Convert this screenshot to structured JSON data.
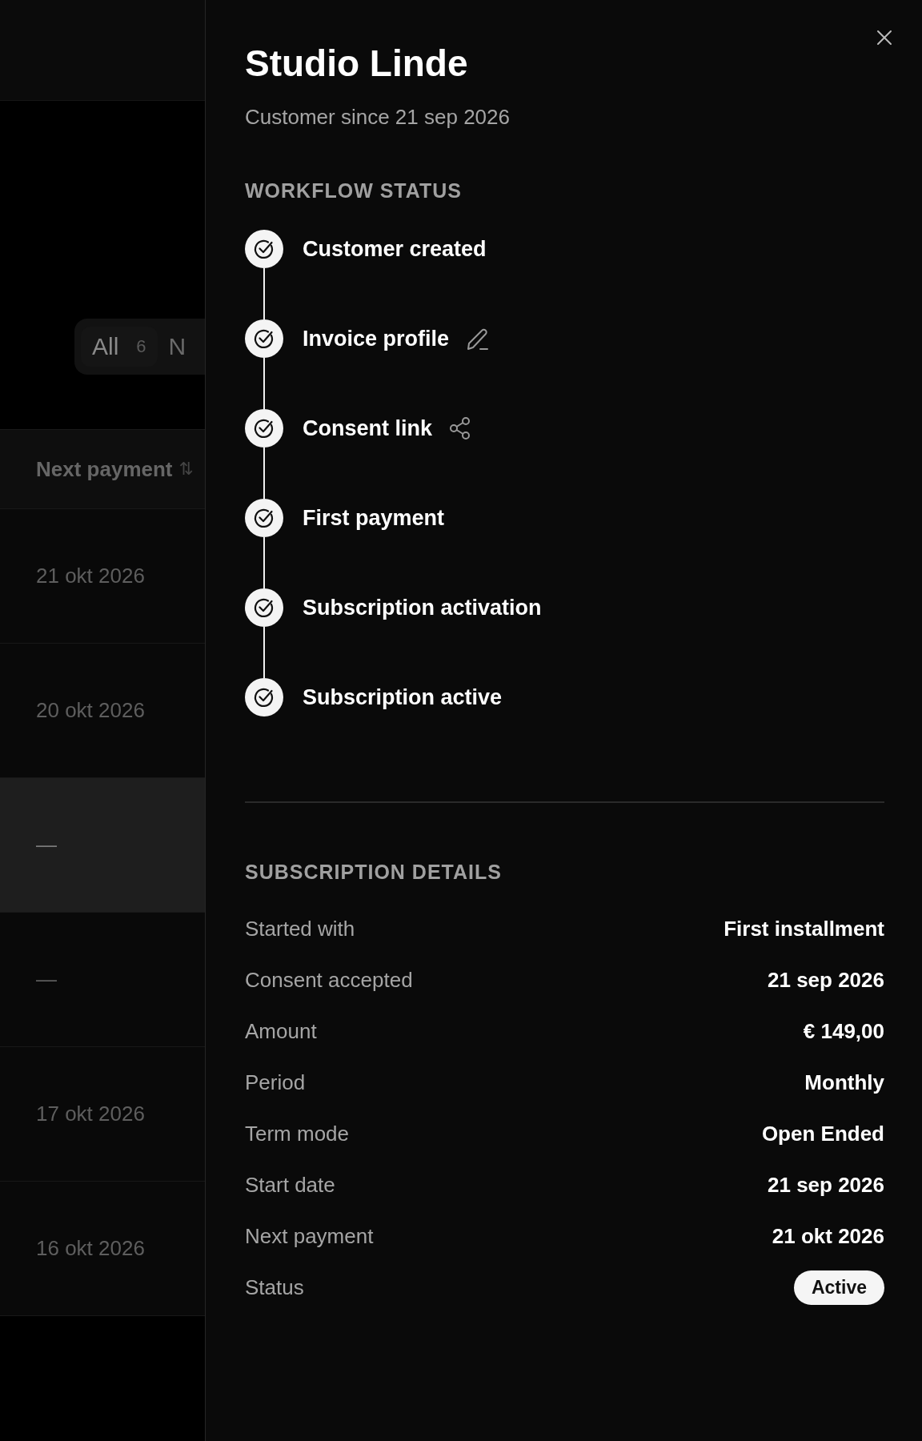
{
  "background": {
    "filter_tabs": [
      {
        "label": "All",
        "count": "6",
        "selected": true
      },
      {
        "label": "N",
        "selected": false
      }
    ],
    "table": {
      "column": {
        "label": "Next payment",
        "sort_icon": "⇅"
      },
      "rows": [
        {
          "value": "21 okt 2026",
          "selected": false
        },
        {
          "value": "20 okt 2026",
          "selected": false
        },
        {
          "value": "—",
          "selected": true
        },
        {
          "value": "—",
          "selected": false
        },
        {
          "value": "17 okt 2026",
          "selected": false
        },
        {
          "value": "16 okt 2026",
          "selected": false
        }
      ]
    }
  },
  "panel": {
    "title": "Studio Linde",
    "subtitle": "Customer since 21 sep 2026",
    "workflow": {
      "heading": "WORKFLOW STATUS",
      "steps": [
        {
          "label": "Customer created",
          "completed": true
        },
        {
          "label": "Invoice profile",
          "completed": true,
          "kind": "edit"
        },
        {
          "label": "Consent link",
          "completed": true,
          "kind": "share"
        },
        {
          "label": "First payment",
          "completed": true
        },
        {
          "label": "Subscription activation",
          "completed": true
        },
        {
          "label": "Subscription active",
          "completed": true
        }
      ]
    },
    "details": {
      "heading": "SUBSCRIPTION DETAILS",
      "rows": [
        {
          "label": "Started with",
          "value": "First installment",
          "kind": "text"
        },
        {
          "label": "Consent accepted",
          "value": "21 sep 2026",
          "kind": "text"
        },
        {
          "label": "Amount",
          "value": "€ 149,00",
          "kind": "text"
        },
        {
          "label": "Period",
          "value": "Monthly",
          "kind": "text"
        },
        {
          "label": "Term mode",
          "value": "Open Ended",
          "kind": "text"
        },
        {
          "label": "Start date",
          "value": "21 sep 2026",
          "kind": "text"
        },
        {
          "label": "Next payment",
          "value": "21 okt 2026",
          "kind": "text"
        },
        {
          "label": "Status",
          "value": "Active",
          "kind": "badge"
        }
      ]
    }
  }
}
